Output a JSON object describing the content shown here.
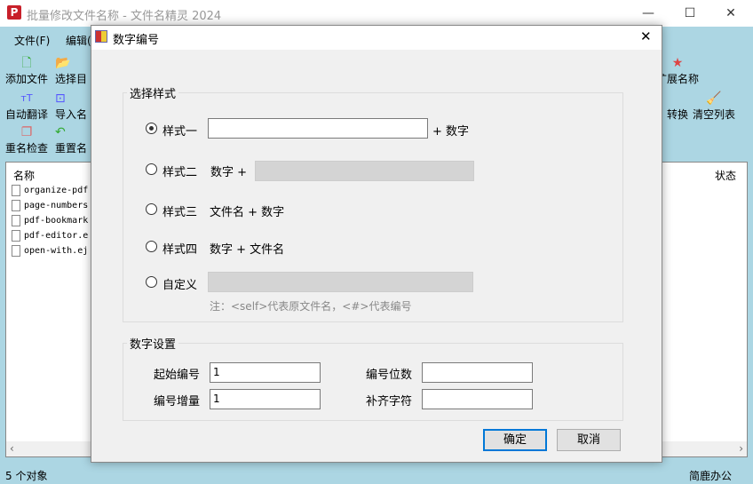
{
  "app": {
    "title": "批量修改文件名称 - 文件名精灵 2024",
    "logo": "P"
  },
  "menu": [
    "文件(F)",
    "编辑("
  ],
  "toolbar": {
    "add_files": "添加文件",
    "select_dir": "选择目",
    "auto_translate": "自动翻译",
    "import_names": "导入名",
    "rename_check": "重名检查",
    "reset_names": "重置名",
    "extend_name": "扩展名称",
    "convert": "转换",
    "clear_list": "清空列表"
  },
  "list": {
    "col_name": "名称",
    "col_status": "状态",
    "files": [
      "organize-pdf",
      "page-numbers",
      "pdf-bookmark",
      "pdf-editor.e",
      "open-with.ej"
    ]
  },
  "status": {
    "count": "5 个对象",
    "brand": "简鹿办公"
  },
  "dialog": {
    "title": "数字编号",
    "style_group": "选择样式",
    "styles": [
      {
        "label": "样式一",
        "suffix": "+ 数字",
        "selected": true
      },
      {
        "label": "样式二",
        "prefix": "数字 +"
      },
      {
        "label": "样式三",
        "text": "文件名 + 数字"
      },
      {
        "label": "样式四",
        "text": "数字 + 文件名"
      },
      {
        "label": "自定义"
      }
    ],
    "note": "注：<self>代表原文件名，<#>代表编号",
    "num_group": "数字设置",
    "start_label": "起始编号",
    "start_value": "1",
    "digits_label": "编号位数",
    "digits_value": "",
    "step_label": "编号增量",
    "step_value": "1",
    "pad_label": "补齐字符",
    "pad_value": "",
    "ok": "确定",
    "cancel": "取消"
  }
}
